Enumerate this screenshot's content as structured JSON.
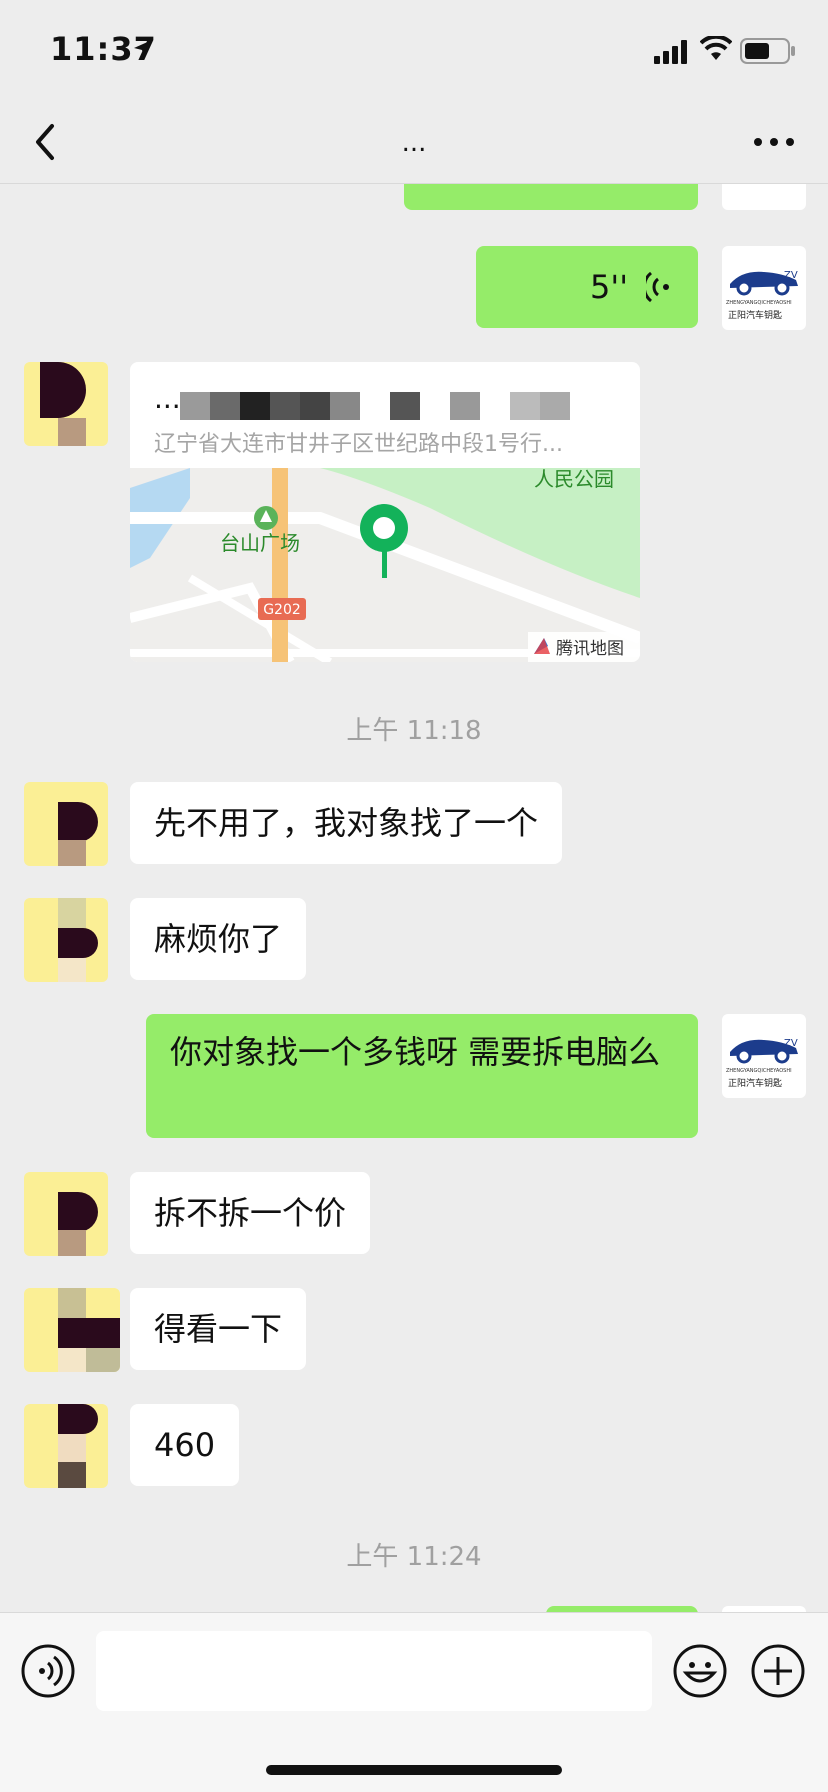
{
  "status_bar": {
    "time": "11:37"
  },
  "header": {
    "title": "..."
  },
  "messages": [
    {
      "type": "voice",
      "duration": "5''"
    },
    {
      "type": "location",
      "title": "...",
      "address": "辽宁省大连市甘井子区世纪路中段1号行...",
      "map_labels": [
        "台山广场",
        "G202",
        "人民公园",
        "腾讯地图"
      ]
    },
    {
      "type": "time",
      "text": "上午 11:18"
    },
    {
      "type": "text_in",
      "text": "先不用了，我对象找了一个"
    },
    {
      "type": "text_in",
      "text": "麻烦你了"
    },
    {
      "type": "text_out",
      "text": "你对象找一个多钱呀  需要拆电脑么"
    },
    {
      "type": "text_in",
      "text": "拆不拆一个价"
    },
    {
      "type": "text_in",
      "text": "得看一下"
    },
    {
      "type": "text_in",
      "text": "460"
    },
    {
      "type": "time",
      "text": "上午 11:24"
    }
  ],
  "own_avatar": {
    "brand": "ZHENGYANGQICHEYAOSHI",
    "brand_cn": "正阳汽车钥匙"
  },
  "colors": {
    "out_bubble": "#95ec69",
    "in_bubble": "#ffffff",
    "background": "#ededed"
  },
  "icons": [
    "location-arrow-icon",
    "signal-icon",
    "wifi-icon",
    "battery-icon",
    "back-icon",
    "more-icon",
    "voice-wave-icon",
    "voice-input-icon",
    "emoji-icon",
    "plus-icon"
  ]
}
